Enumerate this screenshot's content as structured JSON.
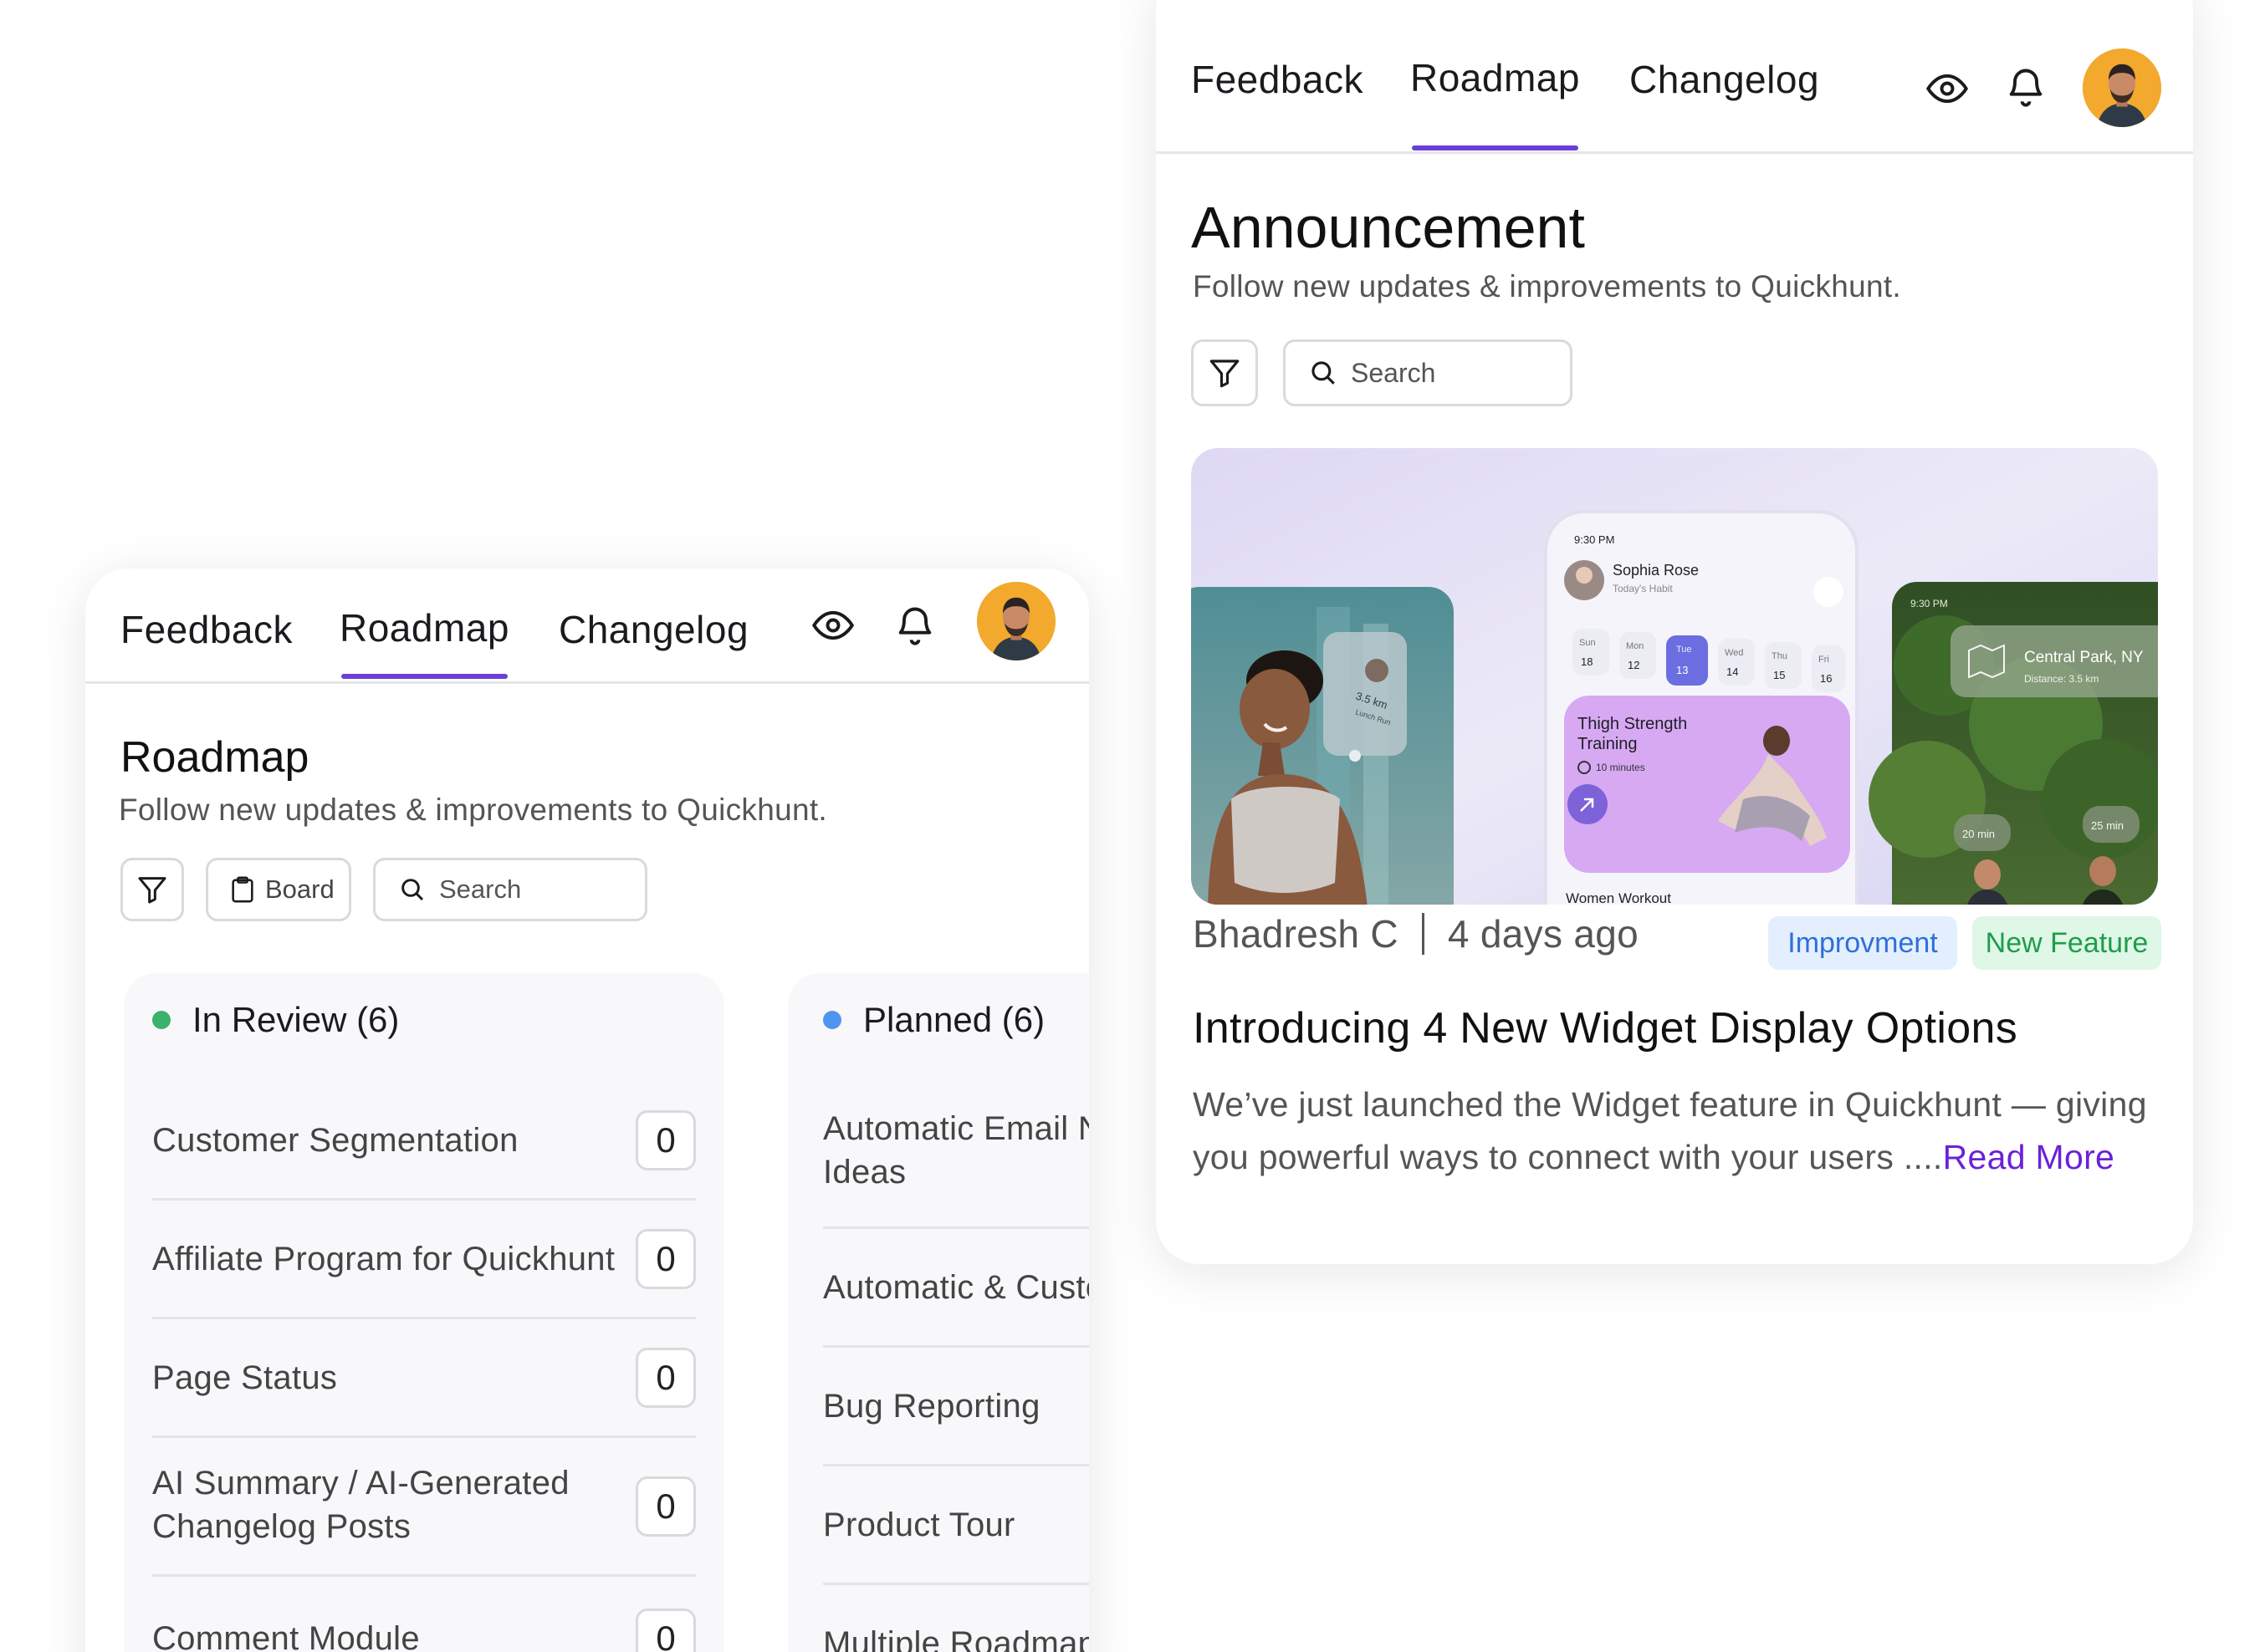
{
  "left_panel": {
    "nav": {
      "tabs": [
        "Feedback",
        "Roadmap",
        "Changelog"
      ],
      "active_tab": "Roadmap"
    },
    "title": "Roadmap",
    "subtitle": "Follow new updates & improvements to Quickhunt.",
    "toolbar": {
      "board_label": "Board",
      "search_placeholder": "Search"
    },
    "columns": [
      {
        "name": "In Review (6)",
        "dot_color": "#3bb26b",
        "items": [
          {
            "label": "Customer Segmentation",
            "votes": "0"
          },
          {
            "label": "Affiliate Program for Quickhunt",
            "votes": "0"
          },
          {
            "label": "Page Status",
            "votes": "0"
          },
          {
            "label_line1": "AI Summary / AI-Generated",
            "label_line2": "Changelog Posts",
            "votes": "0"
          },
          {
            "label": "Comment Module",
            "votes": "0"
          }
        ]
      },
      {
        "name": "Planned (6)",
        "dot_color": "#4f94f0",
        "items": [
          {
            "label_line1": "Automatic Email N",
            "label_line2": "Ideas"
          },
          {
            "label": "Automatic & Custon"
          },
          {
            "label": "Bug Reporting"
          },
          {
            "label": "Product Tour"
          },
          {
            "label": "Multiple Roadmaps"
          }
        ]
      }
    ]
  },
  "right_panel": {
    "nav": {
      "tabs": [
        "Feedback",
        "Roadmap",
        "Changelog"
      ],
      "active_tab": "Roadmap"
    },
    "title": "Announcement",
    "subtitle": "Follow new updates & improvements to Quickhunt.",
    "toolbar": {
      "search_placeholder": "Search"
    },
    "post": {
      "author": "Bhadresh C",
      "time": "4 days ago",
      "tags": [
        "Improvment",
        "New Feature"
      ],
      "title": "Introducing 4 New Widget Display Options",
      "body": "We’ve just launched the Widget feature in Quickhunt — giving you powerful ways to connect with your users ....",
      "read_more": "Read More"
    },
    "hero_image": {
      "phone": {
        "time": "9:30 PM",
        "user": "Sophia Rose",
        "user_sub": "Today's Habit",
        "days": [
          "Sun",
          "Mon",
          "Tue",
          "Wed",
          "Thu",
          "Fri"
        ],
        "dates": [
          "18",
          "12",
          "13",
          "14",
          "15",
          "16"
        ],
        "card_title_line1": "Thigh Strength",
        "card_title_line2": "Training",
        "card_duration": "10 minutes",
        "section": "Women Workout"
      },
      "left_card": {
        "distance": "3.5 km",
        "sub": "Lunch Run"
      },
      "right_card": {
        "time": "9:30 PM",
        "place": "Central Park, NY",
        "distance": "Distance: 3.5 km",
        "chip1": "20 min",
        "chip2": "25 min"
      }
    }
  },
  "colors": {
    "accent": "#6b3fd6",
    "read_more": "#6b21d8"
  }
}
